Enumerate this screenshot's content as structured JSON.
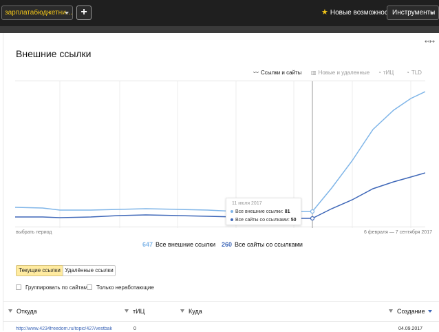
{
  "header": {
    "site_select_label": "зарплатабюджетни…",
    "add_button_label": "+",
    "news_link_label": "Новые возможности",
    "tools_button_label": "Инструменты"
  },
  "page": {
    "title": "Внешние ссылки",
    "expand_icon": "↤↦"
  },
  "chart_tabs": [
    {
      "label": "Ссылки и сайты",
      "icon": "wave-icon",
      "active": true
    },
    {
      "label": "Новые и удаленные",
      "icon": "bars-icon",
      "active": false
    },
    {
      "label": "тИЦ",
      "icon": "clock-icon",
      "active": false
    },
    {
      "label": "TLD",
      "icon": "clock-icon",
      "active": false
    }
  ],
  "chart_data": {
    "type": "line",
    "series": [
      {
        "name": "Все внешние ссылки",
        "color": "#7fb5e8"
      },
      {
        "name": "Все сайты со ссылками",
        "color": "#3e67b8"
      }
    ],
    "tooltip": {
      "date": "11 июля 2017",
      "rows": [
        {
          "label": "Все внешние ссылки:",
          "value": "81"
        },
        {
          "label": "Все сайты со ссылками:",
          "value": "50"
        }
      ]
    },
    "period_label": "выбрать период",
    "range_label": "6 февраля — 7 сентября 2017",
    "grid": true
  },
  "legend": {
    "items": [
      {
        "count": "647",
        "label": "Все внешние ссылки"
      },
      {
        "count": "260",
        "label": "Все сайты со ссылками"
      }
    ]
  },
  "filters": {
    "current_links_label": "Текущие ссылки",
    "deleted_links_label": "Удалённые ссылки",
    "group_by_sites_label": "Группировать по сайтам",
    "only_unprocessed_label": "Только неработающие"
  },
  "table": {
    "columns": {
      "from": "Откуда",
      "tic": "тИЦ",
      "to": "Куда",
      "created": "Создание"
    },
    "partial_row": {
      "from": "http://www.4234freedom.ru/topic/427/vestbak",
      "tic": "0",
      "created": "04.09.2017"
    }
  },
  "colors": {
    "light_series": "#7fb5e8",
    "dark_series": "#3e67b8",
    "accent_yellow": "#f0c419"
  }
}
